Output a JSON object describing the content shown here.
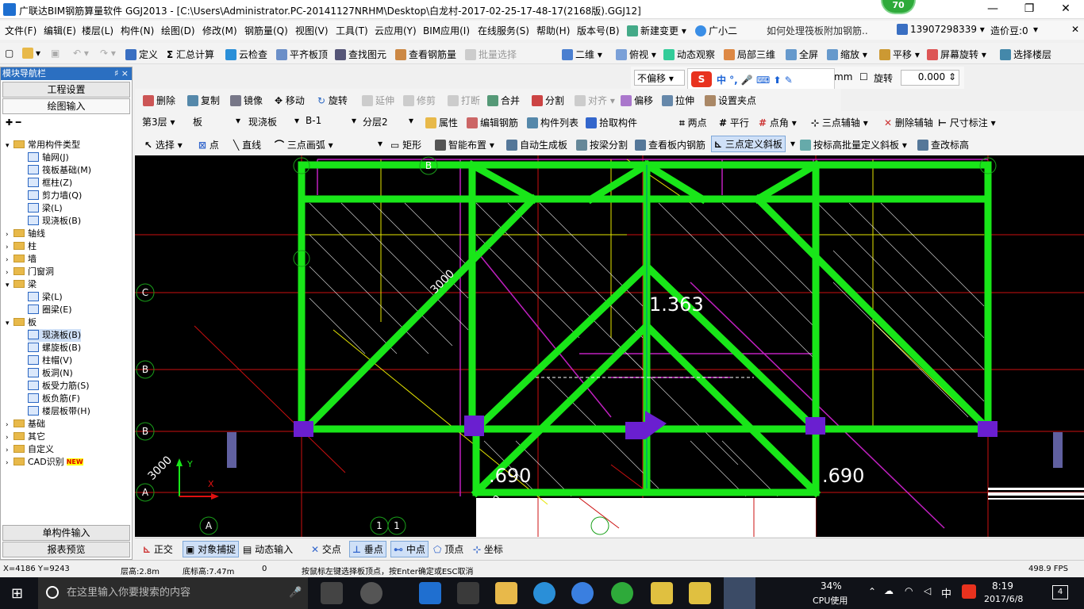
{
  "window": {
    "title": "广联达BIM钢筋算量软件 GGJ2013 - [C:\\Users\\Administrator.PC-20141127NRHM\\Desktop\\白龙村-2017-02-25-17-48-17(2168版).GGJ12]",
    "badge": "70",
    "minimize": "—",
    "restore": "❐",
    "close": "✕"
  },
  "menu": {
    "items": [
      "文件(F)",
      "编辑(E)",
      "楼层(L)",
      "构件(N)",
      "绘图(D)",
      "修改(M)",
      "钢筋量(Q)",
      "视图(V)",
      "工具(T)",
      "云应用(Y)",
      "BIM应用(I)",
      "在线服务(S)",
      "帮助(H)",
      "版本号(B)"
    ],
    "new_change": "新建变更",
    "assistant": "广小二",
    "question": "如何处理筏板附加钢筋..",
    "phone": "13907298339",
    "price": "造价豆:0"
  },
  "toolbar1": {
    "items": [
      "定义",
      "汇总计算",
      "云检查",
      "平齐板顶",
      "查找图元",
      "查看钢筋量",
      "批量选择",
      "二维",
      "俯视",
      "动态观察",
      "局部三维",
      "全屏",
      "缩放",
      "平移",
      "屏幕旋转",
      "选择楼层"
    ]
  },
  "floatbar": {
    "offset_mode": "不偏移",
    "unit": "mm",
    "rotate_label": "旋转",
    "rotate_value": "0.000"
  },
  "toolbar2": {
    "items": [
      "删除",
      "复制",
      "镜像",
      "移动",
      "旋转",
      "延伸",
      "修剪",
      "打断",
      "合并",
      "分割",
      "对齐",
      "偏移",
      "拉伸",
      "设置夹点"
    ]
  },
  "toolbar3": {
    "floor": "第3层",
    "type": "板",
    "subtype": "现浇板",
    "component": "B-1",
    "layer": "分层2",
    "items": [
      "属性",
      "编辑钢筋",
      "构件列表",
      "拾取构件",
      "两点",
      "平行",
      "点角",
      "三点辅轴",
      "删除辅轴",
      "尺寸标注"
    ]
  },
  "toolbar4": {
    "items": [
      "选择",
      "点",
      "直线",
      "三点画弧",
      "矩形",
      "智能布置",
      "自动生成板",
      "按梁分割",
      "查看板内钢筋",
      "三点定义斜板",
      "按标高批量定义斜板",
      "查改标高"
    ]
  },
  "nav": {
    "header": "模块导航栏",
    "pin": "♯ ×",
    "btn_project": "工程设置",
    "btn_draw": "绘图输入",
    "btn_single": "单构件输入",
    "btn_report": "报表预览",
    "tree": [
      {
        "label": "常用构件类型",
        "level": 0,
        "folder": true,
        "open": true
      },
      {
        "label": "轴网(J)",
        "level": 1
      },
      {
        "label": "筏板基础(M)",
        "level": 1
      },
      {
        "label": "框柱(Z)",
        "level": 1
      },
      {
        "label": "剪力墙(Q)",
        "level": 1
      },
      {
        "label": "梁(L)",
        "level": 1
      },
      {
        "label": "现浇板(B)",
        "level": 1
      },
      {
        "label": "轴线",
        "level": 0,
        "folder": true
      },
      {
        "label": "柱",
        "level": 0,
        "folder": true
      },
      {
        "label": "墙",
        "level": 0,
        "folder": true
      },
      {
        "label": "门窗洞",
        "level": 0,
        "folder": true
      },
      {
        "label": "梁",
        "level": 0,
        "folder": true,
        "open": true
      },
      {
        "label": "梁(L)",
        "level": 1
      },
      {
        "label": "圈梁(E)",
        "level": 1
      },
      {
        "label": "板",
        "level": 0,
        "folder": true,
        "open": true
      },
      {
        "label": "现浇板(B)",
        "level": 1,
        "selected": true
      },
      {
        "label": "螺旋板(B)",
        "level": 1
      },
      {
        "label": "柱帽(V)",
        "level": 1
      },
      {
        "label": "板洞(N)",
        "level": 1
      },
      {
        "label": "板受力筋(S)",
        "level": 1
      },
      {
        "label": "板负筋(F)",
        "level": 1
      },
      {
        "label": "楼层板带(H)",
        "level": 1
      },
      {
        "label": "基础",
        "level": 0,
        "folder": true
      },
      {
        "label": "其它",
        "level": 0,
        "folder": true
      },
      {
        "label": "自定义",
        "level": 0,
        "folder": true
      },
      {
        "label": "CAD识别",
        "level": 0,
        "folder": true,
        "badge": "NEW"
      }
    ]
  },
  "canvas": {
    "axis_labels": [
      "B",
      "C",
      "B",
      "B",
      "A",
      "A",
      "1",
      "1",
      "2"
    ],
    "dims": [
      "3000",
      "3000",
      "3000"
    ],
    "elev1": "1.363",
    "elev2": ".690",
    "elev3": ".690",
    "ucs_y": "Y",
    "ucs_x": "X"
  },
  "snapbar": {
    "items": [
      "正交",
      "对象捕捉",
      "动态输入",
      "交点",
      "垂点",
      "中点",
      "顶点",
      "坐标"
    ]
  },
  "status": {
    "coords": "X=4186 Y=9243",
    "floor_height": "层高:2.8m",
    "bottom_elev": "底标高:7.47m",
    "zero": "0",
    "hint": "按鼠标左键选择板顶点，按Enter确定或ESC取消",
    "fps": "498.9 FPS"
  },
  "taskbar": {
    "search": "在这里输入你要搜索的内容",
    "cpu_pct": "34%",
    "cpu_label": "CPU使用",
    "ime": "中",
    "time": "8:19",
    "date": "2017/6/8",
    "notif": "4"
  },
  "colors": {
    "accent": "#2b6fc1",
    "beam": "#19e619",
    "slab_line": "#ffffff",
    "aux_red": "#cc1010",
    "magenta": "#c020c0",
    "yellow": "#e6e600",
    "column": "#6a1fd0"
  }
}
